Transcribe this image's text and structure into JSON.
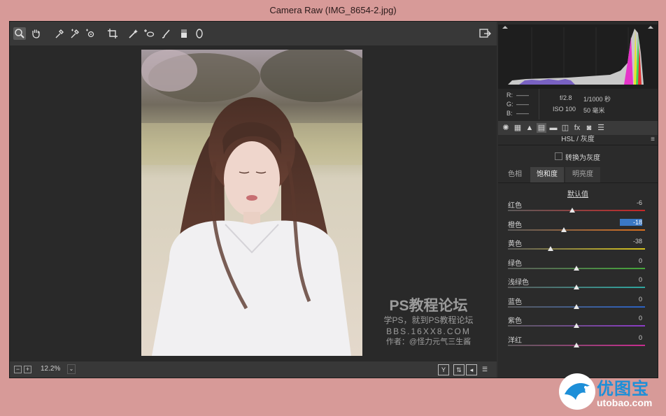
{
  "window": {
    "title": "Camera Raw (IMG_8654-2.jpg)"
  },
  "toolbar": {
    "tools": [
      "zoom-tool",
      "hand-tool",
      "white-balance-tool",
      "color-sampler-tool",
      "targeted-adjustment-tool",
      "crop-tool",
      "straighten-tool",
      "spot-removal-tool",
      "adjustment-brush-tool",
      "graduated-filter-tool",
      "radial-filter-tool"
    ],
    "export_icon": "open-preferences-icon"
  },
  "status": {
    "zoom": "12.2%",
    "zoom_out": "−",
    "zoom_in": "+"
  },
  "info": {
    "r_label": "R:",
    "g_label": "G:",
    "b_label": "B:",
    "r_value": "——",
    "g_value": "——",
    "b_value": "——",
    "aperture": "f/2.8",
    "shutter": "1/1000 秒",
    "iso": "ISO 100",
    "focal": "50 毫米"
  },
  "panel": {
    "title": "HSL / 灰度",
    "convert_gray": "转换为灰度",
    "tabs": [
      "色相",
      "饱和度",
      "明亮度"
    ],
    "active_tab": 1,
    "default_link": "默认值"
  },
  "sliders": [
    {
      "label": "红色",
      "value": "-6",
      "num": -6,
      "selected": false,
      "track": "#c62828"
    },
    {
      "label": "橙色",
      "value": "-18",
      "num": -18,
      "selected": true,
      "track": "#d9701f"
    },
    {
      "label": "黄色",
      "value": "-38",
      "num": -38,
      "selected": false,
      "track": "#d6c21c"
    },
    {
      "label": "绿色",
      "value": "0",
      "num": 0,
      "selected": false,
      "track": "#45a63a"
    },
    {
      "label": "浅绿色",
      "value": "0",
      "num": 0,
      "selected": false,
      "track": "#2ea7a0"
    },
    {
      "label": "蓝色",
      "value": "0",
      "num": 0,
      "selected": false,
      "track": "#2b62c4"
    },
    {
      "label": "紫色",
      "value": "0",
      "num": 0,
      "selected": false,
      "track": "#8b3bc7"
    },
    {
      "label": "洋红",
      "value": "0",
      "num": 0,
      "selected": false,
      "track": "#c92c8f"
    }
  ],
  "watermark": {
    "line1": "PS教程论坛",
    "line2": "学PS，就到PS教程论坛",
    "line3": "BBS.16XX8.COM",
    "line4": "作者：@怪力元气三生酱"
  },
  "brand": {
    "name_cn": "优图宝",
    "domain": "utobao.com"
  }
}
